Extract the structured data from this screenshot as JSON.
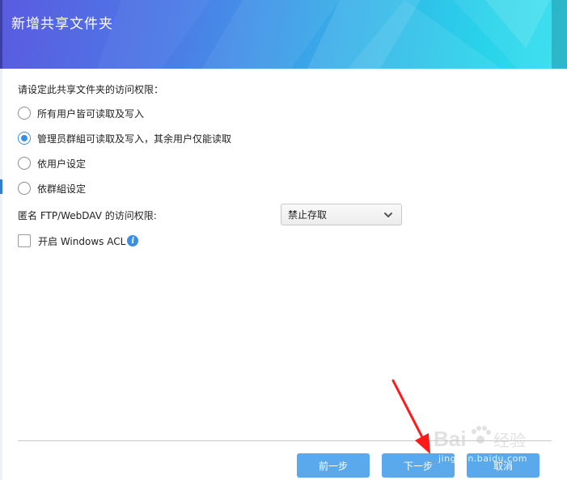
{
  "dialog": {
    "title": "新增共享文件夹"
  },
  "permissions": {
    "prompt": "请设定此共享文件夹的访问权限：",
    "options": [
      {
        "label": "所有用户皆可读取及写入",
        "checked": false
      },
      {
        "label": "管理员群組可读取及写入，其余用户仅能读取",
        "checked": true
      },
      {
        "label": "依用户设定",
        "checked": false
      },
      {
        "label": "依群組设定",
        "checked": false
      }
    ]
  },
  "ftp": {
    "label": "匿名 FTP/WebDAV 的访问权限:",
    "selected": "禁止存取"
  },
  "acl": {
    "label": "开启 Windows ACL",
    "checked": false
  },
  "footer": {
    "prev_label": "前一步",
    "next_label": "下一步",
    "cancel_label": "取消"
  },
  "watermark": {
    "brand": "Bai",
    "brand_cn": "经验",
    "url": "jingyan.baidu.com"
  },
  "colors": {
    "accent": "#3b8ee6",
    "button": "#5aa9ec",
    "annotation_arrow": "#ff1a1a"
  },
  "icons": {
    "select_chevron": "chevron-down-icon",
    "acl_info": "info-icon",
    "watermark_paw": "paw-icon"
  }
}
